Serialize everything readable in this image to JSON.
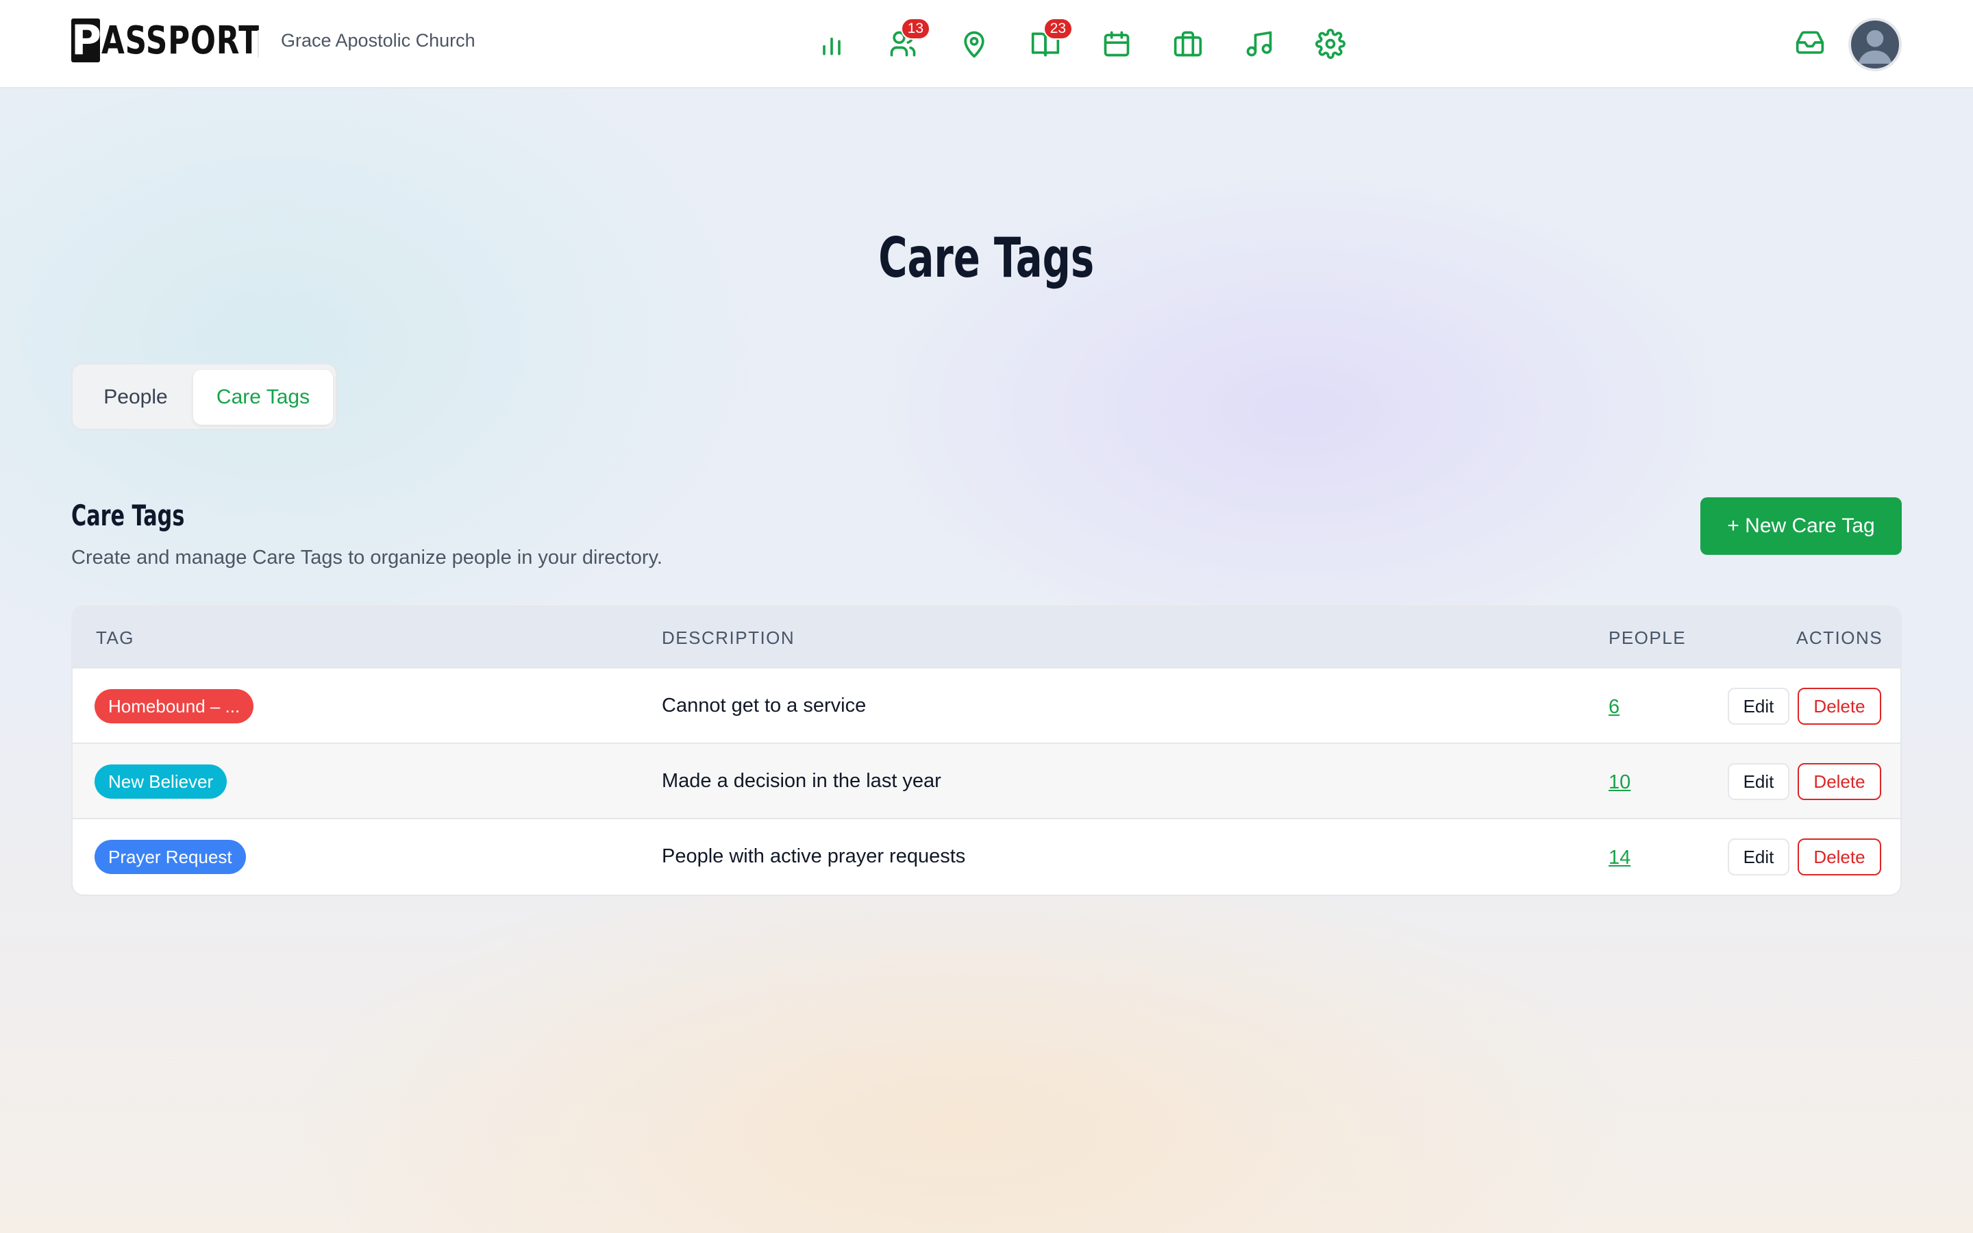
{
  "header": {
    "logo_first": "P",
    "logo_rest": "ASSPORT",
    "church_name": "Grace Apostolic Church",
    "nav": [
      {
        "icon": "chart-icon",
        "badge": ""
      },
      {
        "icon": "people-icon",
        "badge": "13"
      },
      {
        "icon": "location-pin-icon",
        "badge": ""
      },
      {
        "icon": "book-icon",
        "badge": "23"
      },
      {
        "icon": "calendar-icon",
        "badge": ""
      },
      {
        "icon": "briefcase-icon",
        "badge": ""
      },
      {
        "icon": "music-icon",
        "badge": ""
      },
      {
        "icon": "gear-icon",
        "badge": ""
      }
    ]
  },
  "page": {
    "title": "Care Tags"
  },
  "tabs": [
    {
      "label": "People",
      "active": false
    },
    {
      "label": "Care Tags",
      "active": true
    }
  ],
  "section": {
    "title": "Care Tags",
    "subtitle": "Create and manage Care Tags to organize people in your directory.",
    "new_button": "+ New Care Tag"
  },
  "table": {
    "headers": [
      "TAG",
      "DESCRIPTION",
      "PEOPLE",
      "ACTIONS"
    ],
    "rows": [
      {
        "tag": "Homebound – ...",
        "color": "#ef4444",
        "description": "Cannot get to a service",
        "people": "6",
        "edit": "Edit",
        "delete": "Delete"
      },
      {
        "tag": "New Believer",
        "color": "#06b6d4",
        "description": "Made a decision in the last year",
        "people": "10",
        "edit": "Edit",
        "delete": "Delete"
      },
      {
        "tag": "Prayer Request",
        "color": "#3b82f6",
        "description": "People with active prayer requests",
        "people": "14",
        "edit": "Edit",
        "delete": "Delete"
      }
    ]
  },
  "colors": {
    "accent": "#16a34a",
    "danger": "#dc2626"
  }
}
